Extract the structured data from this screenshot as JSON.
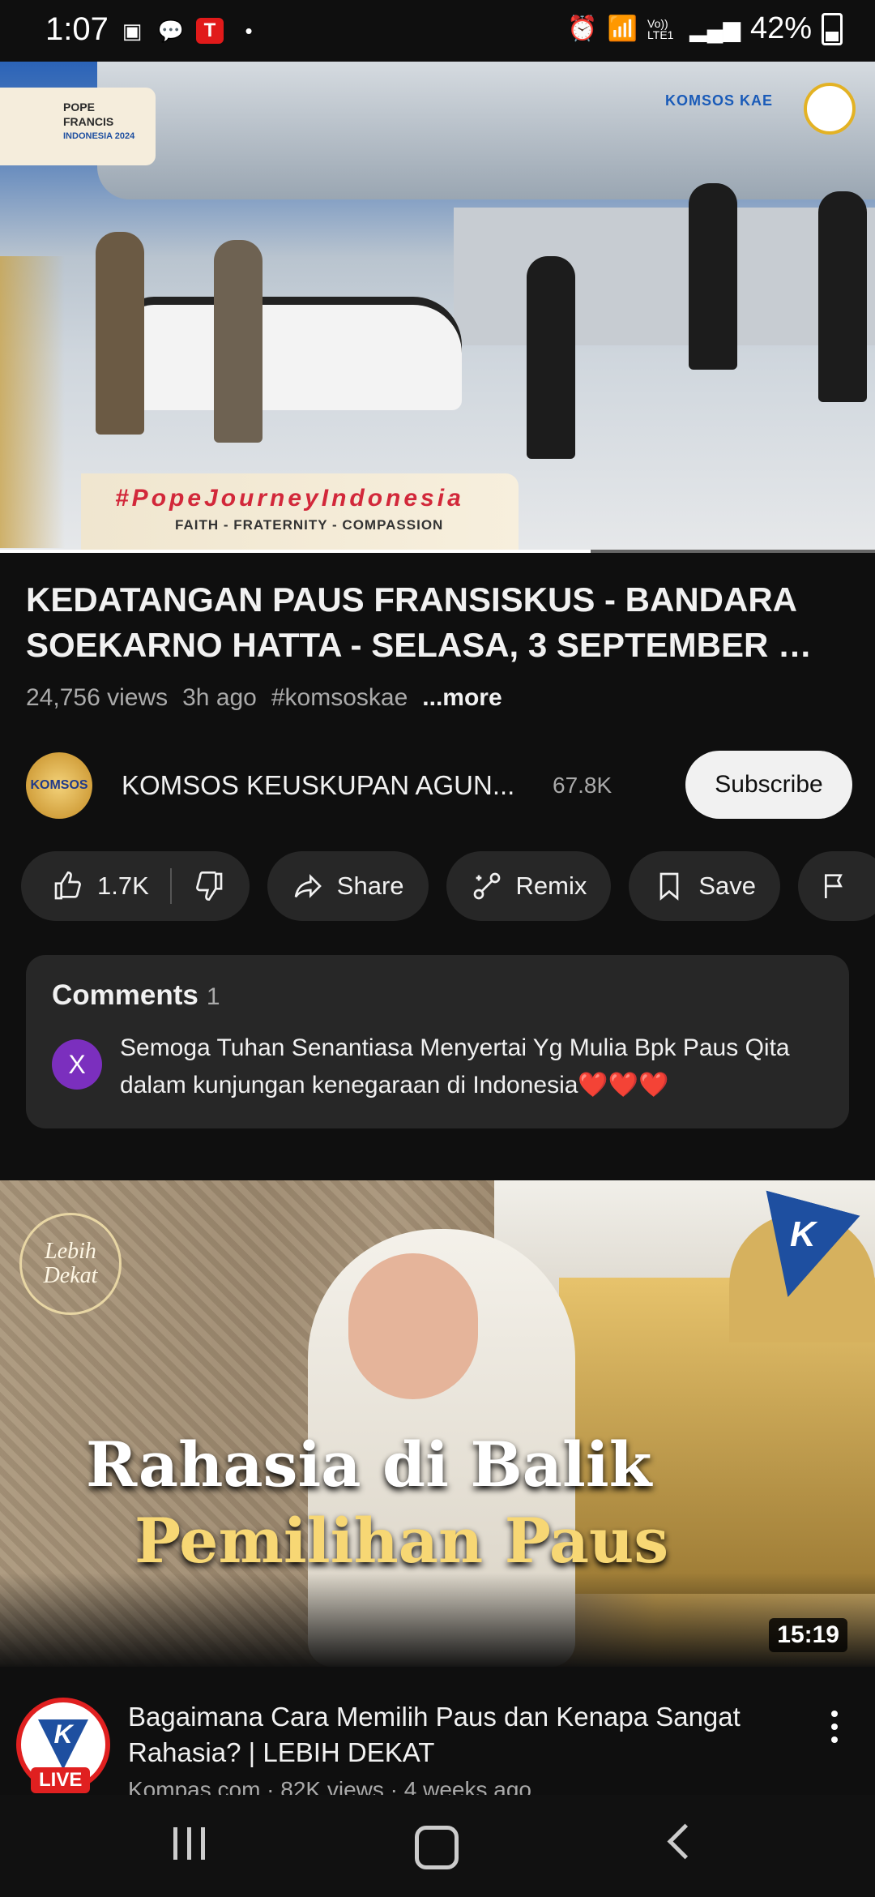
{
  "status_bar": {
    "time": "1:07",
    "battery": "42%",
    "network_label": "Vo)) LTE1"
  },
  "player": {
    "badge_title_lines": [
      "POPE",
      "FRANCIS"
    ],
    "badge_sub": "INDONESIA 2024",
    "channel_watermark": "KOMSOS KAE",
    "banner_hashtag": "#PopeJourneyIndonesia",
    "banner_tagline": "FAITH - FRATERNITY - COMPASSION",
    "progress_fraction": 0.675
  },
  "video": {
    "title": "KEDATANGAN PAUS FRANSISKUS - BANDARA SOEKARNO HATTA - SELASA, 3 SEPTEMBER …",
    "views": "24,756 views",
    "age": "3h ago",
    "hashtag": "#komsoskae",
    "more": "...more"
  },
  "channel": {
    "avatar_text": "KOMSOS",
    "name": "KOMSOS KEUSKUPAN AGUN...",
    "subscribers": "67.8K",
    "subscribe_label": "Subscribe"
  },
  "actions": {
    "likes": "1.7K",
    "share": "Share",
    "remix": "Remix",
    "save": "Save"
  },
  "comments": {
    "title": "Comments",
    "count": "1",
    "avatar_letter": "X",
    "top_comment": "Semoga Tuhan Senantiasa Menyertai Yg Mulia Bpk Paus Qita dalam kunjungan kenegaraan di Indonesia❤️❤️❤️"
  },
  "next_video": {
    "thumb_badge": "Lebih Dekat",
    "thumb_logo": "K",
    "headline_line1": "Rahasia di Balik",
    "headline_line2": "Pemilihan Paus",
    "duration": "15:19",
    "title": "Bagaimana Cara Memilih Paus dan Kenapa Sangat Rahasia? | LEBIH DEKAT",
    "meta": "Kompas.com · 82K views · 4 weeks ago",
    "live_label": "LIVE",
    "avatar_letter": "K"
  }
}
